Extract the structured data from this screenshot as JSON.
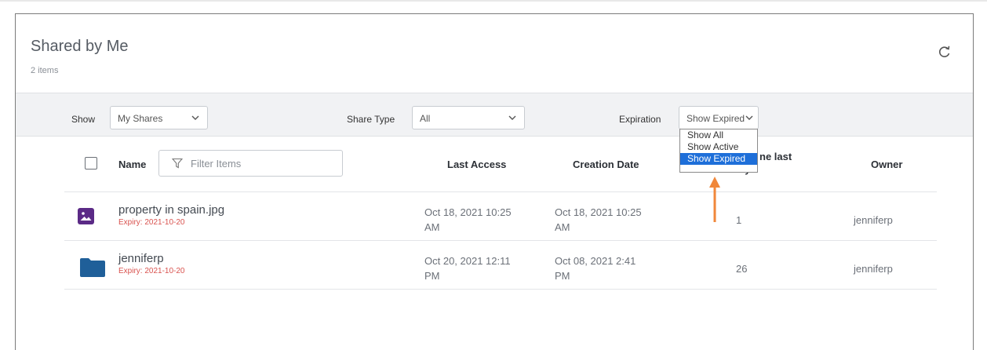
{
  "header": {
    "title": "Shared by Me",
    "count": "2 items"
  },
  "filters": {
    "show_label": "Show",
    "show_value": "My Shares",
    "type_label": "Share Type",
    "type_value": "All",
    "exp_label": "Expiration",
    "exp_value": "Show Expired",
    "exp_options": [
      "Show All",
      "Show Active",
      "Show Expired"
    ]
  },
  "table": {
    "col_name": "Name",
    "filter_placeholder": "Filter Items",
    "col_last_access": "Last Access",
    "col_creation": "Creation Date",
    "col_downloads_partial_1": "ne last",
    "col_downloads_partial_2": "30 days",
    "col_owner": "Owner",
    "rows": [
      {
        "name": "property in spain.jpg",
        "expiry": "Expiry: 2021-10-20",
        "last_access_1": "Oct 18, 2021 10:25",
        "last_access_2": "AM",
        "created_1": "Oct 18, 2021 10:25",
        "created_2": "AM",
        "downloads": "1",
        "owner": "jenniferp",
        "icon": "image-file-icon"
      },
      {
        "name": "jenniferp",
        "expiry": "Expiry: 2021-10-20",
        "last_access_1": "Oct 20, 2021 12:11",
        "last_access_2": "PM",
        "created_1": "Oct 08, 2021 2:41",
        "created_2": "PM",
        "downloads": "26",
        "owner": "jenniferp",
        "icon": "folder-icon"
      }
    ]
  },
  "colors": {
    "accent": "#1e6fd9",
    "expiry": "#d9534f",
    "arrow": "#f0873a",
    "image_icon": "#5b2a86",
    "folder_icon": "#1f5f99"
  }
}
